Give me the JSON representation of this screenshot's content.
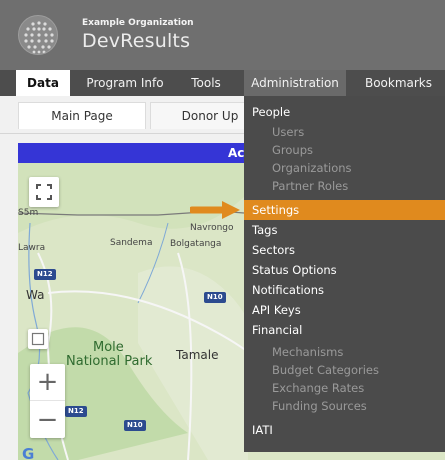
{
  "header": {
    "org_name": "Example Organization",
    "app_name": "DevResults",
    "logo_icon": "globe-dots-logo"
  },
  "nav": {
    "items": [
      {
        "label": "Data",
        "active": true
      },
      {
        "label": "Program Info"
      },
      {
        "label": "Tools"
      },
      {
        "label": "Administration"
      },
      {
        "label": "Bookmarks"
      }
    ]
  },
  "subtabs": [
    {
      "label": "Main Page",
      "active": true
    },
    {
      "label": "Donor Up"
    }
  ],
  "banner": {
    "text": "Ac"
  },
  "map": {
    "labels": {
      "navrongo": "Navrongo",
      "sandema": "Sandema",
      "bolgatanga": "Bolgatanga",
      "lawra": "Lawra",
      "wa": "Wa",
      "mole": "Mole",
      "national_park": "National Park",
      "tamale": "Tamale",
      "left_edge": "S5m"
    },
    "roads": [
      "N12",
      "N10",
      "N12",
      "N10"
    ],
    "zoom_in": "+",
    "zoom_out": "−",
    "google_fragment": "G"
  },
  "dropdown": {
    "items": [
      {
        "label": "People",
        "type": "section"
      },
      {
        "label": "Users",
        "type": "sub"
      },
      {
        "label": "Groups",
        "type": "sub"
      },
      {
        "label": "Organizations",
        "type": "sub"
      },
      {
        "label": "Partner Roles",
        "type": "sub"
      },
      {
        "label": "Settings",
        "type": "section",
        "highlight": true
      },
      {
        "label": "Tags",
        "type": "section"
      },
      {
        "label": "Sectors",
        "type": "section"
      },
      {
        "label": "Status Options",
        "type": "section"
      },
      {
        "label": "Notifications",
        "type": "section"
      },
      {
        "label": "API Keys",
        "type": "section"
      },
      {
        "label": "Financial",
        "type": "section"
      },
      {
        "label": "Mechanisms",
        "type": "sub"
      },
      {
        "label": "Budget Categories",
        "type": "sub"
      },
      {
        "label": "Exchange Rates",
        "type": "sub"
      },
      {
        "label": "Funding Sources",
        "type": "sub"
      },
      {
        "label": "IATI",
        "type": "section"
      }
    ]
  },
  "colors": {
    "accent_orange": "#e08a1e",
    "banner_blue": "#3535d6",
    "nav_dark": "#4d4d4d",
    "dropdown_bg": "#4b4b4b"
  }
}
